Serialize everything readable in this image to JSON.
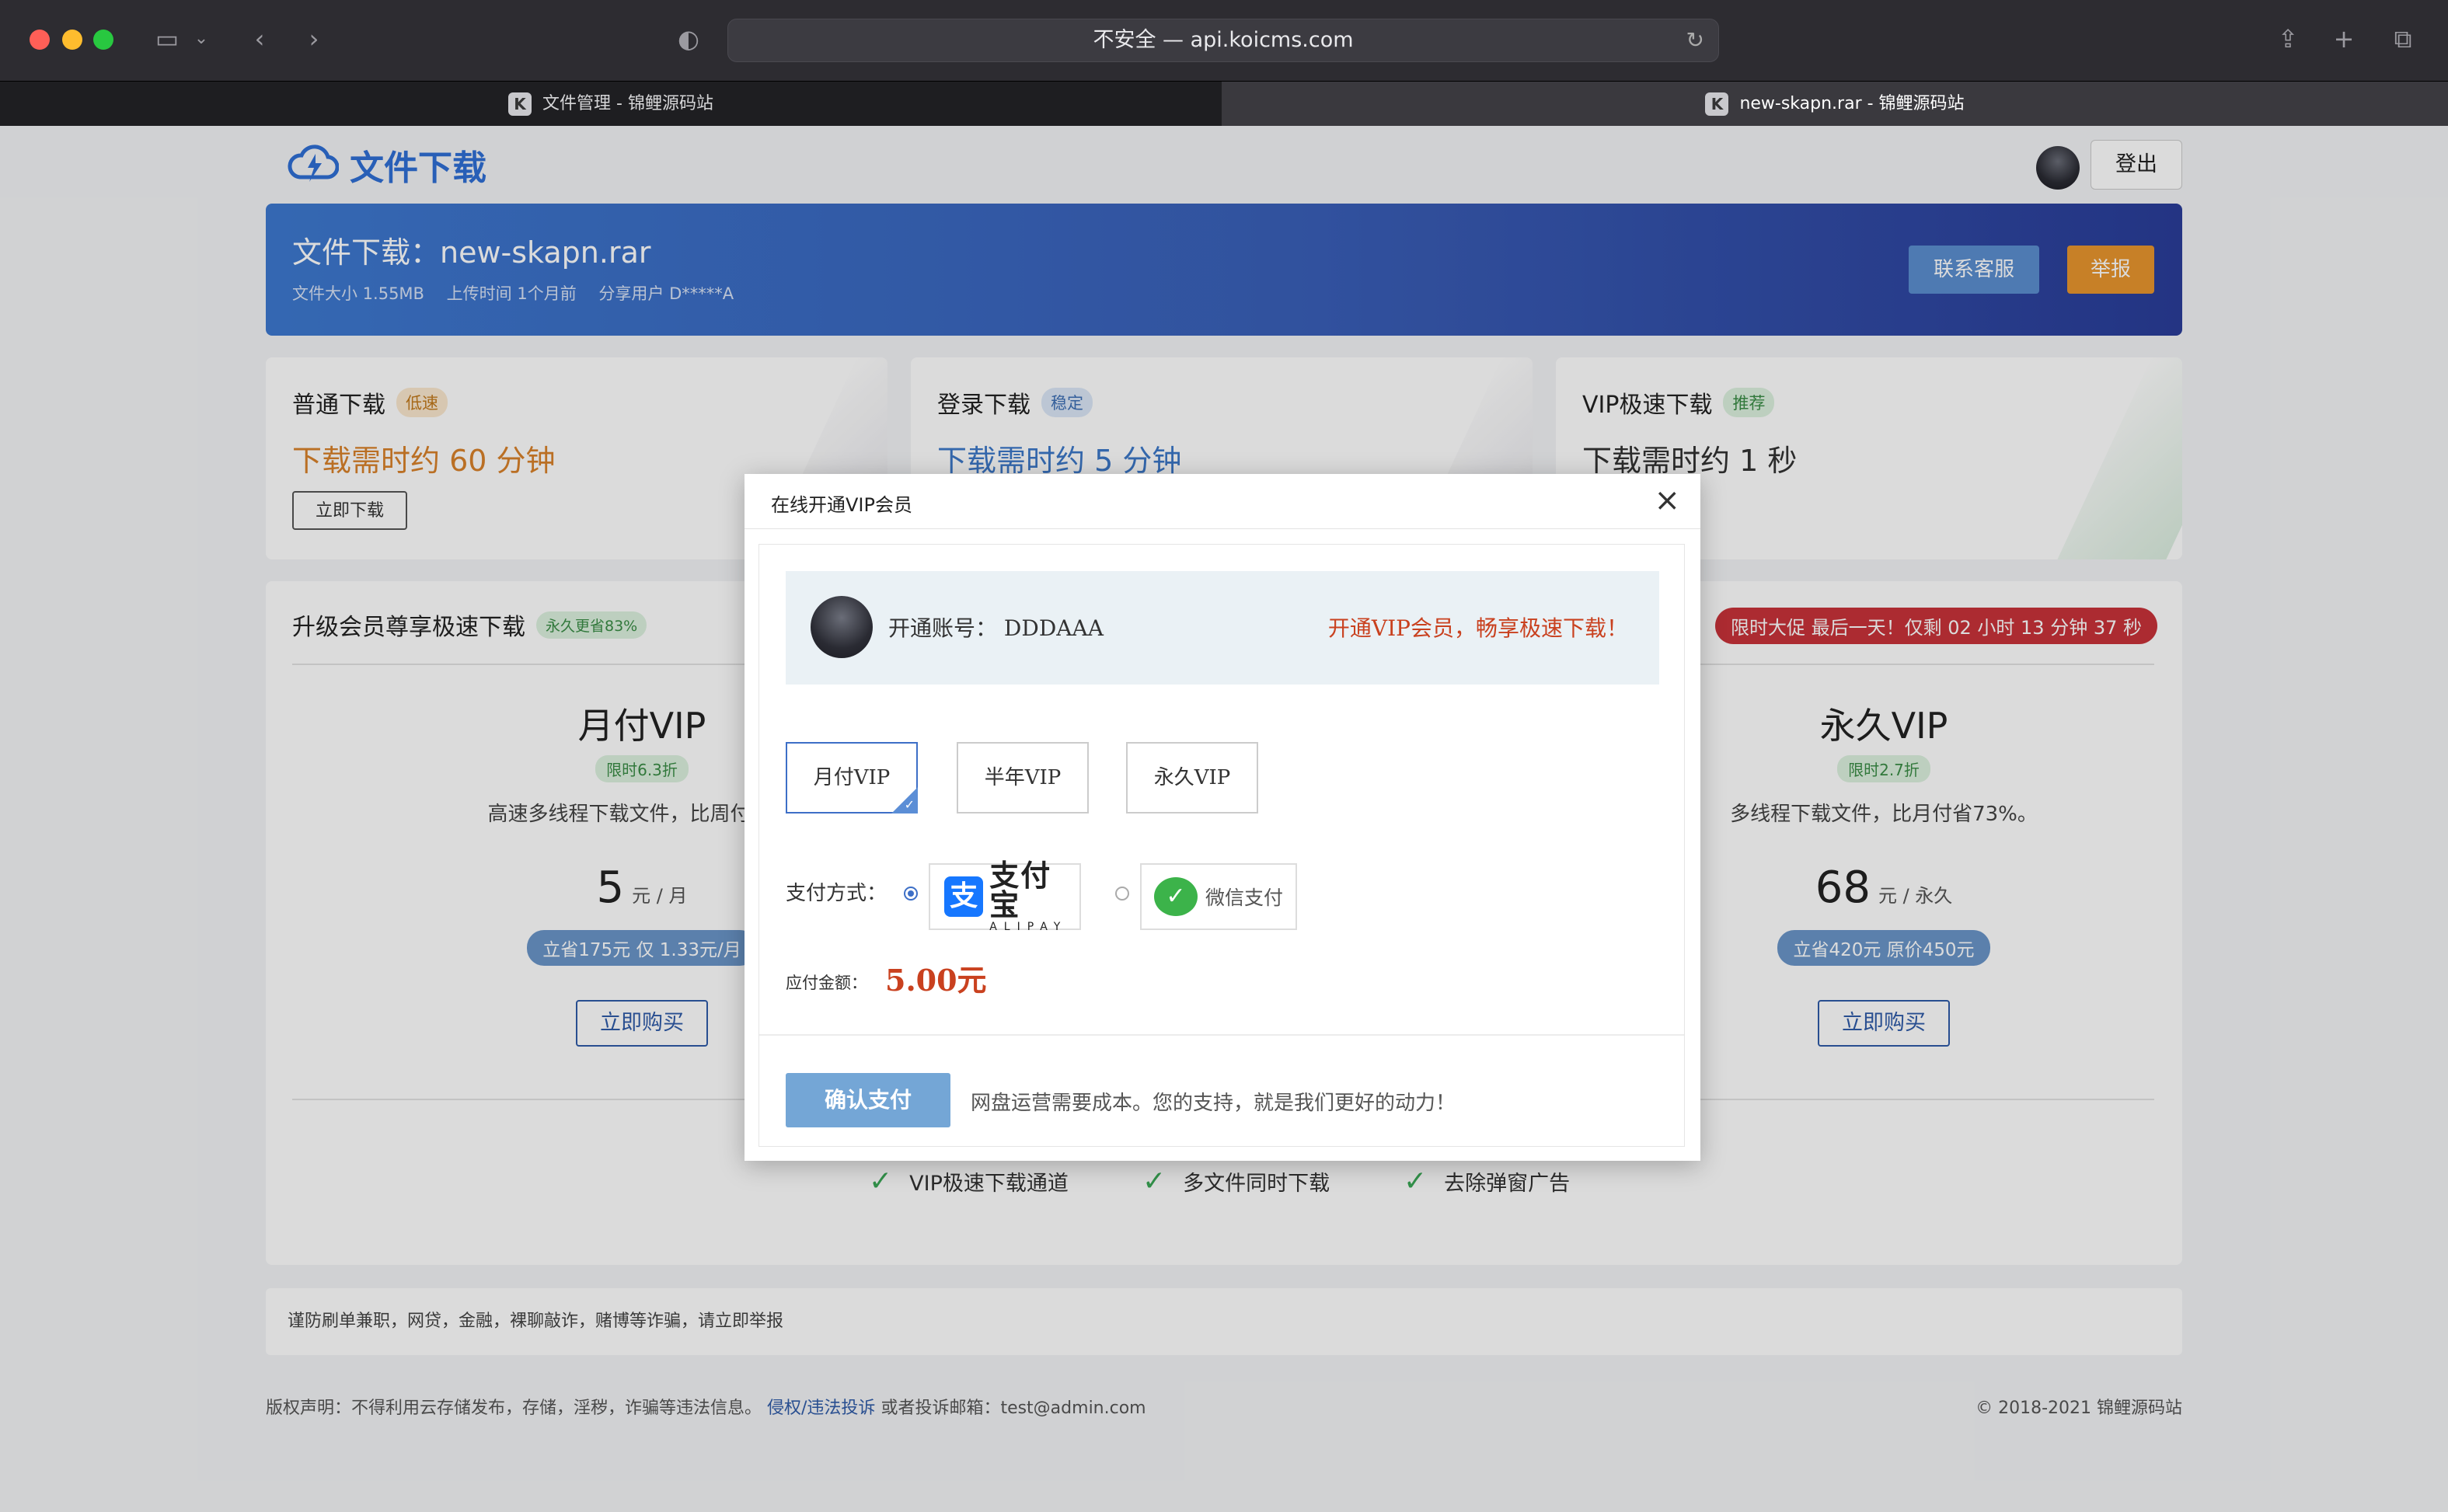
{
  "browser": {
    "address": "不安全 — api.koicms.com",
    "tabs": [
      {
        "label": "文件管理 - 锦鲤源码站",
        "favicon": "K",
        "active": false
      },
      {
        "label": "new-skapn.rar - 锦鲤源码站",
        "favicon": "K",
        "active": true
      }
    ],
    "icons": [
      "sidebar-icon",
      "chevron-down-icon",
      "back-icon",
      "forward-icon",
      "shield-icon",
      "reload-icon",
      "share-icon",
      "plus-icon",
      "tabs-overview-icon"
    ]
  },
  "header": {
    "logo_text": "文件下载",
    "logout": "登出"
  },
  "banner": {
    "title": "文件下载：new-skapn.rar",
    "size": "文件大小 1.55MB",
    "upload_time": "上传时间 1个月前",
    "share_user": "分享用户 D*****A",
    "service_button": "联系客服",
    "report_button": "举报"
  },
  "download_cards": [
    {
      "title": "普通下载",
      "badge": "低速",
      "eta": "下载需时约 60 分钟",
      "button": "立即下载"
    },
    {
      "title": "登录下载",
      "badge": "稳定",
      "eta": "下载需时约 5 分钟"
    },
    {
      "title": "VIP极速下载",
      "badge": "推荐",
      "eta": "下载需时约 1 秒"
    }
  ],
  "vip": {
    "heading": "升级会员尊享极速下载",
    "heading_badge": "永久更省83%",
    "promo": "限时大促 最后一天！仅剩 02 小时 13 分钟 37 秒",
    "plans": [
      {
        "name": "月付VIP",
        "tag": "限时6.3折",
        "desc": "高速多线程下载文件，比周付省11",
        "price": "5",
        "unit": "元 / 月",
        "save": "立省175元 仅 1.33元/月",
        "buy": "立即购买"
      },
      {
        "name": "永久VIP",
        "tag": "限时2.7折",
        "desc": "多线程下载文件，比月付省73%。",
        "price": "68",
        "unit": "元 / 永久",
        "save": "立省420元 原价450元",
        "buy": "立即购买"
      }
    ],
    "features": [
      "VIP极速下载通道",
      "多文件同时下载",
      "去除弹窗广告"
    ]
  },
  "warning": "谨防刷单兼职，网贷，金融，裸聊敲诈，赌博等诈骗，请立即举报",
  "footer": {
    "left_text": "版权声明：不得利用云存储发布，存储，淫秽，诈骗等违法信息。",
    "link": "侵权/违法投诉",
    "left_tail": "或者投诉邮箱：test@admin.com",
    "right": "© 2018-2021 锦鲤源码站"
  },
  "modal": {
    "title": "在线开通VIP会员",
    "account_label": "开通账号：",
    "account_name": "DDDAAA",
    "slogan": "开通VIP会员，畅享极速下载！",
    "plans": [
      "月付VIP",
      "半年VIP",
      "永久VIP"
    ],
    "selected_plan": "月付VIP",
    "pay_label": "支付方式：",
    "alipay_cn": "支付宝",
    "alipay_en": "ALIPAY",
    "wechat": "微信支付",
    "selected_payment": "alipay",
    "amount_label": "应付金额：",
    "amount": "5.00元",
    "confirm": "确认支付",
    "note": "网盘运营需要成本。您的支持，就是我们更好的动力！"
  },
  "colors": {
    "brand_blue": "#2f6fd6",
    "report_orange": "#e8962e",
    "promo_red": "#c9333a",
    "price_red": "#c9411f",
    "confirm_blue": "#74a6d6"
  }
}
